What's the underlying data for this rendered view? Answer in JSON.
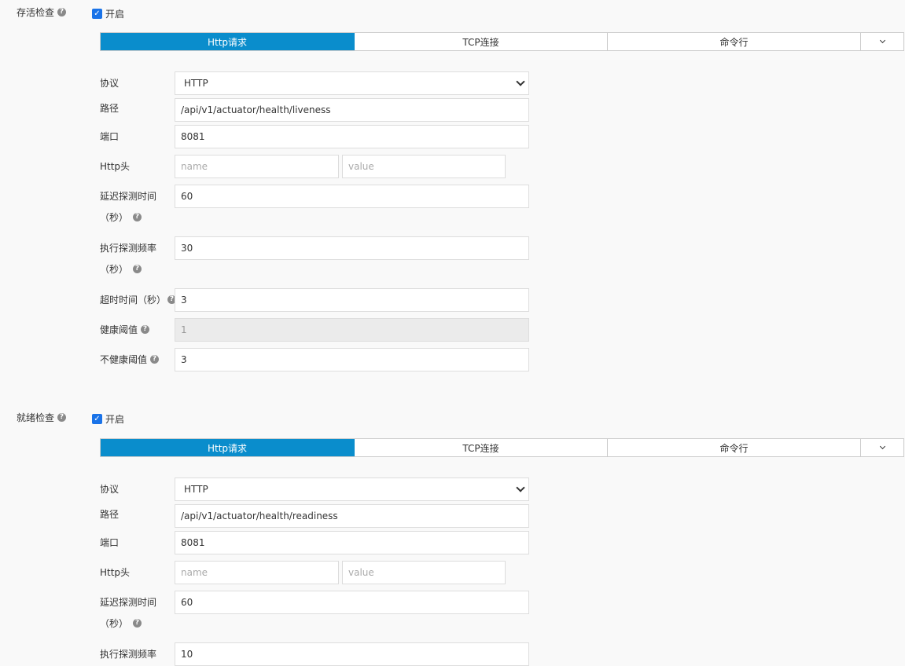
{
  "liveness": {
    "title": "存活检查",
    "enable_label": "开启",
    "tabs": [
      "Http请求",
      "TCP连接",
      "命令行"
    ],
    "protocol_label": "协议",
    "protocol_value": "HTTP",
    "path_label": "路径",
    "path_value": "/api/v1/actuator/health/liveness",
    "port_label": "端口",
    "port_value": "8081",
    "header_label": "Http头",
    "header_name_placeholder": "name",
    "header_value_placeholder": "value",
    "delay_label_1": "延迟探测时间",
    "delay_label_2": "（秒）",
    "delay_value": "60",
    "period_label_1": "执行探测频率",
    "period_label_2": "（秒）",
    "period_value": "30",
    "timeout_label": "超时时间（秒）",
    "timeout_value": "3",
    "success_label": "健康阈值",
    "success_value": "1",
    "failure_label": "不健康阈值",
    "failure_value": "3"
  },
  "readiness": {
    "title": "就绪检查",
    "enable_label": "开启",
    "tabs": [
      "Http请求",
      "TCP连接",
      "命令行"
    ],
    "protocol_label": "协议",
    "protocol_value": "HTTP",
    "path_label": "路径",
    "path_value": "/api/v1/actuator/health/readiness",
    "port_label": "端口",
    "port_value": "8081",
    "header_label": "Http头",
    "header_name_placeholder": "name",
    "header_value_placeholder": "value",
    "delay_label_1": "延迟探测时间",
    "delay_label_2": "（秒）",
    "delay_value": "60",
    "period_label_1": "执行探测频率",
    "period_value": "10"
  },
  "colors": {
    "active_tab": "#0a8dcc",
    "checkbox": "#1a73e8"
  }
}
